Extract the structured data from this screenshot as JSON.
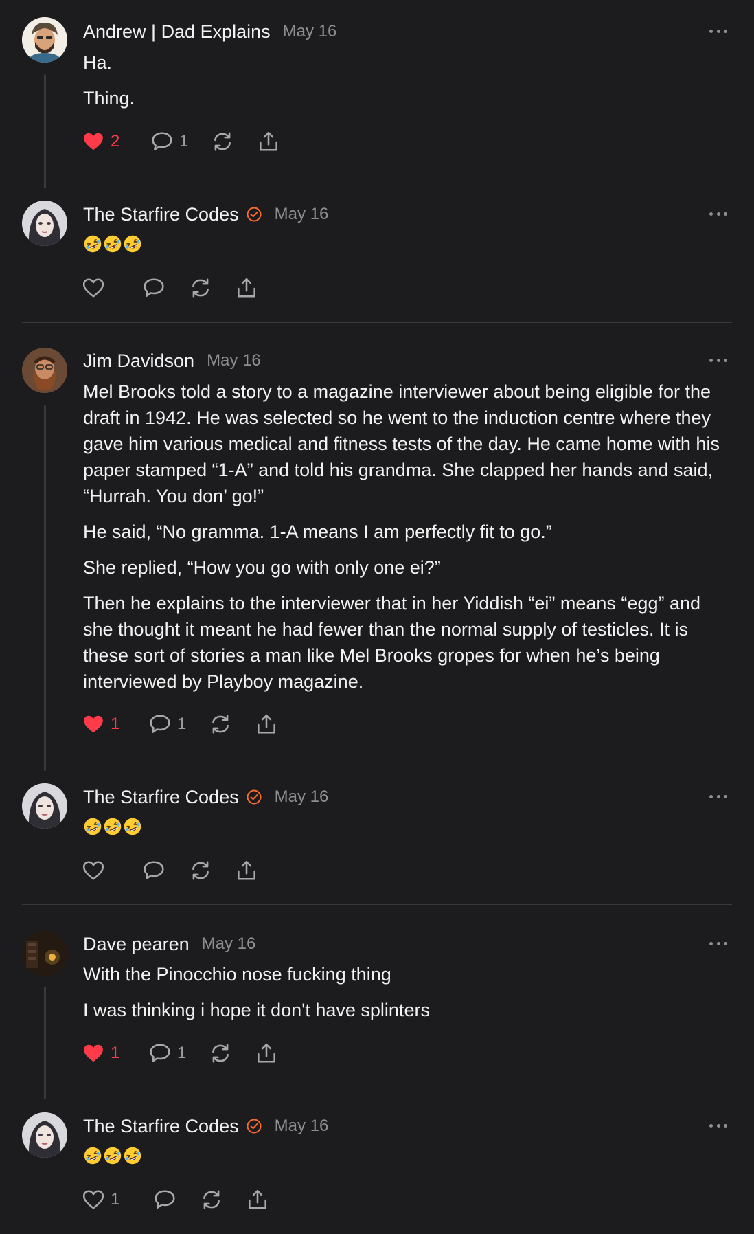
{
  "colors": {
    "background": "#1c1c1e",
    "like_red": "#ff3b4a",
    "verified_orange": "#ff6a2a",
    "muted": "#8e8e93"
  },
  "posts": [
    {
      "author": "Andrew | Dad Explains",
      "date": "May 16",
      "paragraphs": [
        "Ha.",
        "Thing."
      ],
      "likes": "2",
      "replies": "1",
      "liked": true
    },
    {
      "author": "The Starfire Codes",
      "verified": true,
      "date": "May 16",
      "emoji": "rolling-on-floor-laughing x3",
      "liked": false
    },
    {
      "author": "Jim Davidson",
      "date": "May 16",
      "paragraphs": [
        "Mel Brooks told a story to a magazine interviewer about being eligible for the draft in 1942. He was selected so he went to the induction centre where they gave him various medical and fitness tests of the day. He came home with his paper stamped “1-A” and told his grandma. She clapped her hands and said, “Hurrah. You don’ go!”",
        "He said, “No gramma. 1-A means I am perfectly fit to go.”",
        "She replied, “How you go with only one ei?”",
        "Then he explains to the interviewer that in her Yiddish “ei” means “egg” and she thought it meant he had fewer than the normal supply of testicles. It is these sort of stories a man like Mel Brooks gropes for when he’s being interviewed by Playboy magazine."
      ],
      "likes": "1",
      "replies": "1",
      "liked": true
    },
    {
      "author": "The Starfire Codes",
      "verified": true,
      "date": "May 16",
      "emoji": "rolling-on-floor-laughing x3",
      "liked": false
    },
    {
      "author": "Dave pearen",
      "date": "May 16",
      "paragraphs": [
        "With the Pinocchio nose fucking thing",
        "I was thinking i hope it don't have splinters"
      ],
      "likes": "1",
      "replies": "1",
      "liked": true
    },
    {
      "author": "The Starfire Codes",
      "verified": true,
      "date": "May 16",
      "emoji": "rolling-on-floor-laughing x3",
      "likes": "1",
      "liked": false
    }
  ]
}
